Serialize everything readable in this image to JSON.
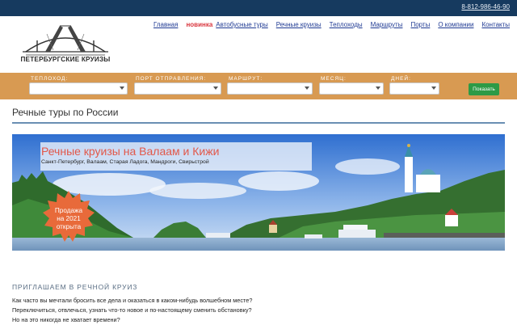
{
  "topbar": {
    "phone": "8-812-986-46-90"
  },
  "logo": {
    "text": "ПЕТЕРБУРГСКИЕ КРУИЗЫ",
    "icon": "drawbridge-logo"
  },
  "nav": {
    "items": [
      {
        "label": "Главная"
      },
      {
        "badge": "новинка",
        "label": "Автобусные туры"
      },
      {
        "label": "Речные круизы"
      },
      {
        "label": "Теплоходы"
      },
      {
        "label": "Маршруты"
      },
      {
        "label": "Порты"
      },
      {
        "label": "О компании"
      },
      {
        "label": "Контакты"
      }
    ]
  },
  "search": {
    "fields": [
      {
        "label": "ТЕПЛОХОД:",
        "value": ""
      },
      {
        "label": "ПОРТ ОТПРАВЛЕНИЯ:",
        "value": ""
      },
      {
        "label": "МАРШРУТ:",
        "value": ""
      },
      {
        "label": "МЕСЯЦ:",
        "value": ""
      },
      {
        "label": "ДНЕЙ:",
        "value": ""
      }
    ],
    "button": "Показать"
  },
  "page": {
    "title": "Речные туры по России"
  },
  "banner": {
    "title": "Речные круизы на Валаам и Кижи",
    "subtitle": "Санкт-Петербург, Валаам, Старая Ладога, Мандроги, Свирьстрой",
    "sale_badge": [
      "Продажа",
      "на 2021",
      "открыта"
    ],
    "colors": {
      "badge": "#e86a3a",
      "title": "#e2584a"
    }
  },
  "intro": {
    "heading": "ПРИГЛАШАЕМ В РЕЧНОЙ КРУИЗ",
    "text": "Как часто вы мечтали бросить все дела и оказаться в каком-нибудь волшебном месте? Переключиться, отвлечься, узнать что-то новое и по-настоящему сменить обстановку? Но на это никогда не хватает времени?"
  },
  "colors": {
    "topbar": "#163a5f",
    "search_bar": "#d89a52",
    "show_button": "#2d9a46",
    "link": "#1f3a93"
  }
}
